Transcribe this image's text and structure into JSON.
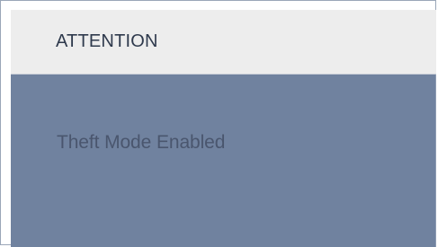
{
  "dialog": {
    "title": "ATTENTION",
    "message": "Theft Mode Enabled"
  },
  "colors": {
    "header_background": "#ededed",
    "panel_background": "#70829f",
    "title_text": "#2f3a4d",
    "message_text": "#4a566e"
  }
}
